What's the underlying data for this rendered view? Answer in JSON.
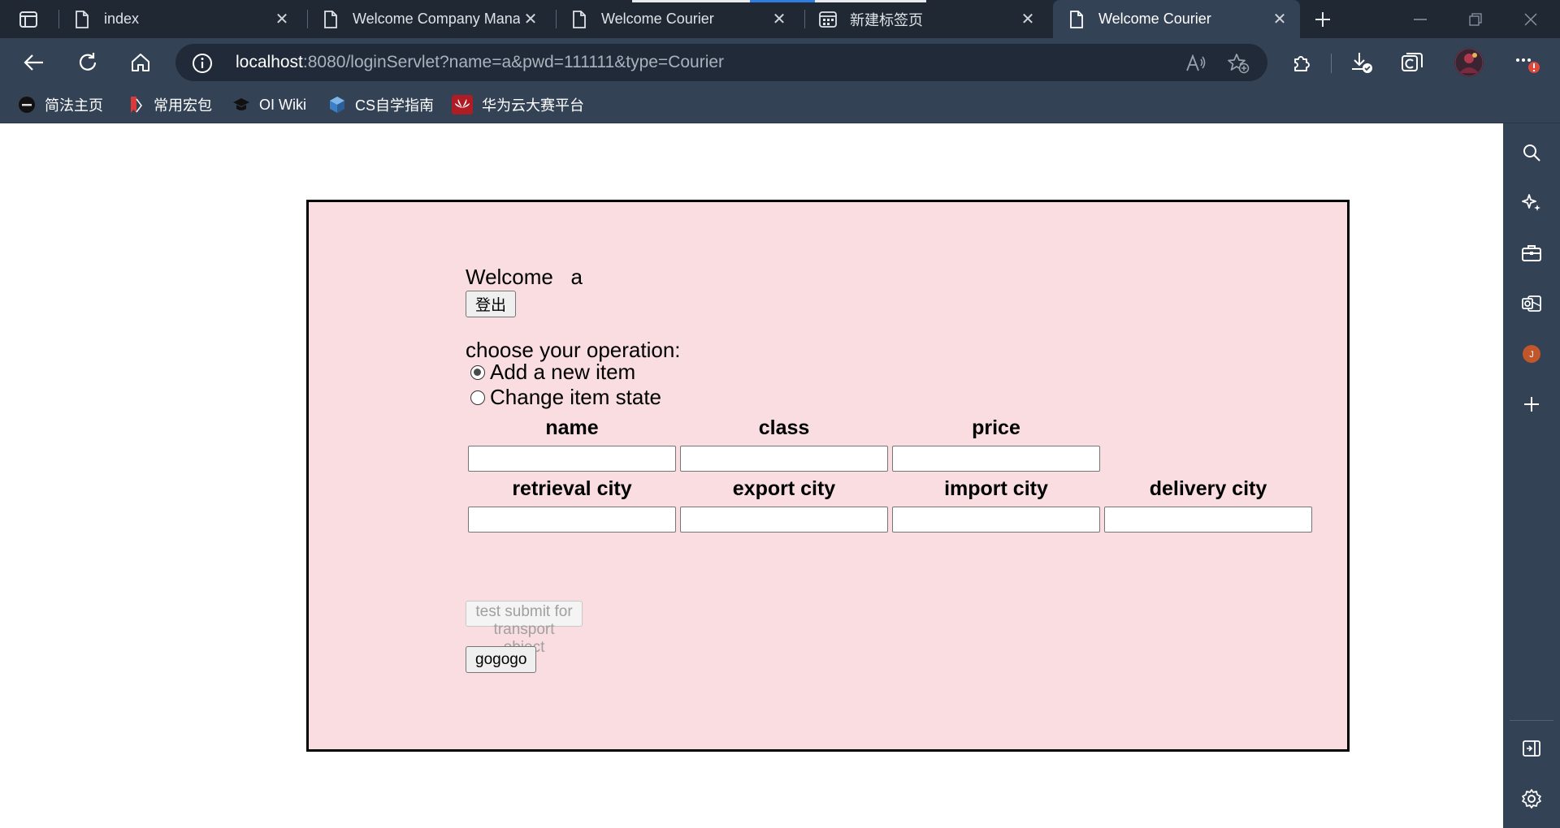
{
  "browser": {
    "tabs": [
      {
        "title": "index",
        "active": false
      },
      {
        "title": "Welcome Company Manag",
        "active": false
      },
      {
        "title": "Welcome Courier",
        "active": false
      },
      {
        "title": "新建标签页",
        "active": false
      },
      {
        "title": "Welcome Courier",
        "active": true
      }
    ],
    "address": {
      "host": "localhost",
      "rest": ":8080/loginServlet?name=a&pwd=111111&type=Courier"
    },
    "favorites": [
      {
        "label": "简法主页",
        "icon": "jianfa-icon"
      },
      {
        "label": "常用宏包",
        "icon": "bookmark-red-icon"
      },
      {
        "label": "OI Wiki",
        "icon": "graduation-cap-icon"
      },
      {
        "label": "CS自学指南",
        "icon": "cube-icon"
      },
      {
        "label": "华为云大赛平台",
        "icon": "huawei-icon"
      }
    ],
    "profile_badge": "J",
    "colors": {
      "tabstrip": "#202833",
      "toolbar": "#344256",
      "panel": "#f9dde0",
      "alert_badge": "#e0483e",
      "profile_badge": "#c0562a"
    }
  },
  "page": {
    "welcome": "Welcome   a",
    "logout_label": "登出",
    "operation_title": "choose your operation:",
    "options": [
      {
        "label": "Add a new item",
        "checked": true
      },
      {
        "label": "Change item state",
        "checked": false
      }
    ],
    "row1_labels": [
      "name",
      "class",
      "price"
    ],
    "row2_labels": [
      "retrieval city",
      "export city",
      "import city",
      "delivery city"
    ],
    "test_submit_label": "test submit for transport object",
    "go_label": "gogogo"
  }
}
